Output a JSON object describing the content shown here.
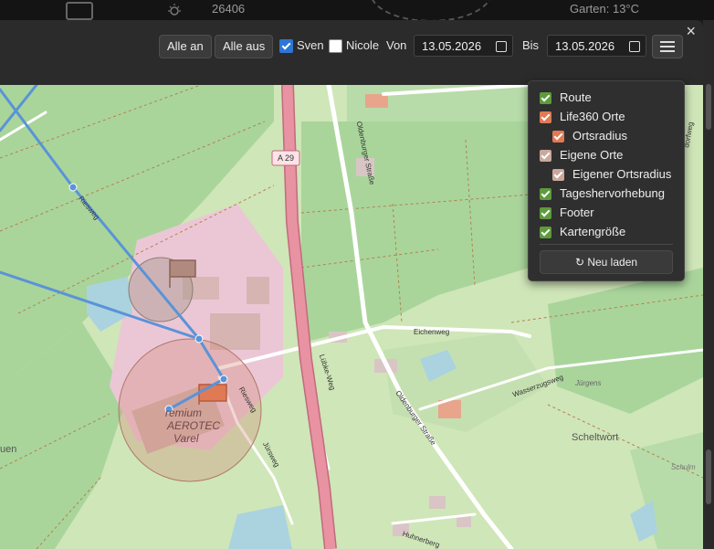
{
  "background": {
    "number": "26406",
    "garten": "Garten:  13°C",
    "icons": [
      "news-icon",
      "sun-icon",
      "gauge-icon"
    ]
  },
  "modal": {
    "close_label": "×"
  },
  "toolbar": {
    "all_on": "Alle an",
    "all_off": "Alle aus",
    "person1": {
      "label": "Sven",
      "checked": true
    },
    "person2": {
      "label": "Nicole",
      "checked": false
    },
    "from_label": "Von",
    "from_value": "13.05.2026",
    "to_label": "Bis",
    "to_value": "13.05.2026",
    "menu_icon": "hamburger-icon",
    "check_color": "#2d76d6"
  },
  "dropdown": {
    "items": [
      {
        "label": "Route",
        "checked": true,
        "color": "#5d9b3c"
      },
      {
        "label": "Life360 Orte",
        "checked": true,
        "color": "#e07a55"
      },
      {
        "label": "Ortsradius",
        "checked": true,
        "color": "#e07a55"
      },
      {
        "label": "Eigene Orte",
        "checked": true,
        "color": "#c9a99b"
      },
      {
        "label": "Eigener Ortsradius",
        "checked": true,
        "color": "#c9a99b"
      },
      {
        "label": "Tageshervorhebung",
        "checked": true,
        "color": "#5d9b3c"
      },
      {
        "label": "Footer",
        "checked": true,
        "color": "#5d9b3c"
      },
      {
        "label": "Kartengröße",
        "checked": true,
        "color": "#5d9b3c"
      }
    ],
    "reload_label": "↻ Neu laden"
  },
  "map": {
    "labels": {
      "a29": "A 29",
      "oldenburger1": "Oldenburger Straße",
      "oldenburger2": "Oldenburger Straße",
      "eichenweg": "Eichenweg",
      "luebke": "Lübke-Weg",
      "riesweg1": "Riesweg",
      "riesweg2": "Riesweg",
      "juersweg": "Jürsweg",
      "wasserzugsweg": "Wasserzugsweg",
      "juergens": "Jürgens",
      "scheltwort": "Scheltwort",
      "premium": "remium",
      "aerotec": "AEROTEC",
      "varel": "Varel",
      "huhnerberg": "Huhnerberg",
      "schulm": "Schulm",
      "uen": "uen",
      "dorfweg": "dorfweg"
    },
    "colors": {
      "forest": "#a9d59b",
      "meadow": "#cfe6b8",
      "motorway": "#e892a2",
      "route": "#5a93d8",
      "industrial": "#ebc7d6",
      "water": "#aad3df"
    }
  }
}
